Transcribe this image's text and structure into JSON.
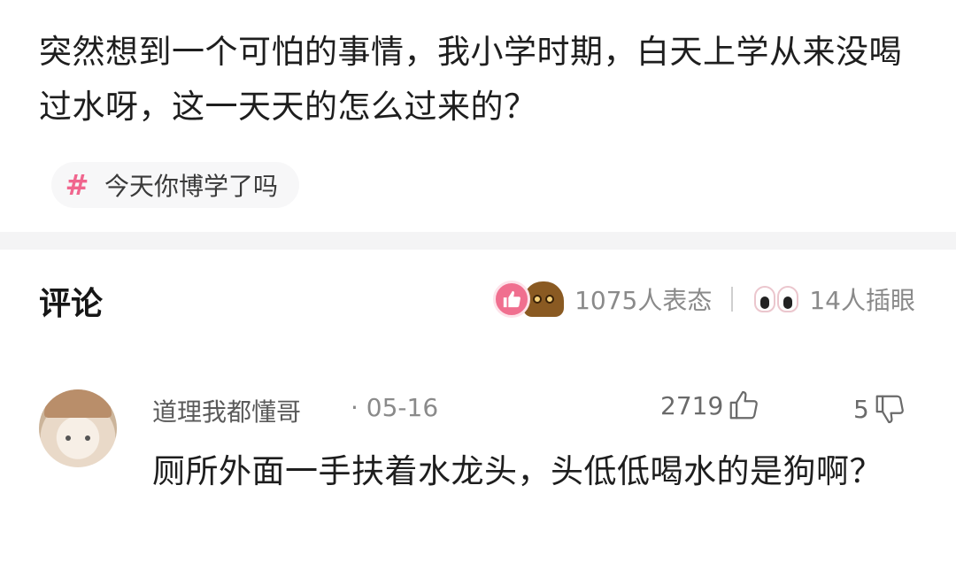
{
  "post": {
    "text": "突然想到一个可怕的事情，我小学时期，白天上学从来没喝过水呀，这一天天的怎么过来的？",
    "topic": {
      "hash_symbol": "#",
      "label": "今天你博学了吗"
    }
  },
  "comments_section": {
    "title": "评论",
    "reactions": {
      "reaction_count_text": "1075人表态",
      "eyes_count_text": "14人插眼"
    }
  },
  "comment": {
    "username": "道理我都懂哥",
    "date": "· 05-16",
    "likes": "2719",
    "dislikes": "5",
    "text": "厕所外面一手扶着水龙头，头低低喝水的是狗啊？"
  },
  "colors": {
    "accent_pink": "#f0668e",
    "muted_text": "#8a8a8a",
    "divider": "#f4f4f5"
  },
  "icons": {
    "topic": "hash-icon",
    "like_reaction": "thumbs-up-reaction-icon",
    "face_reaction": "face-reaction-icon",
    "eyes": "eyes-icon",
    "like": "thumbs-up-icon",
    "dislike": "thumbs-down-icon"
  }
}
